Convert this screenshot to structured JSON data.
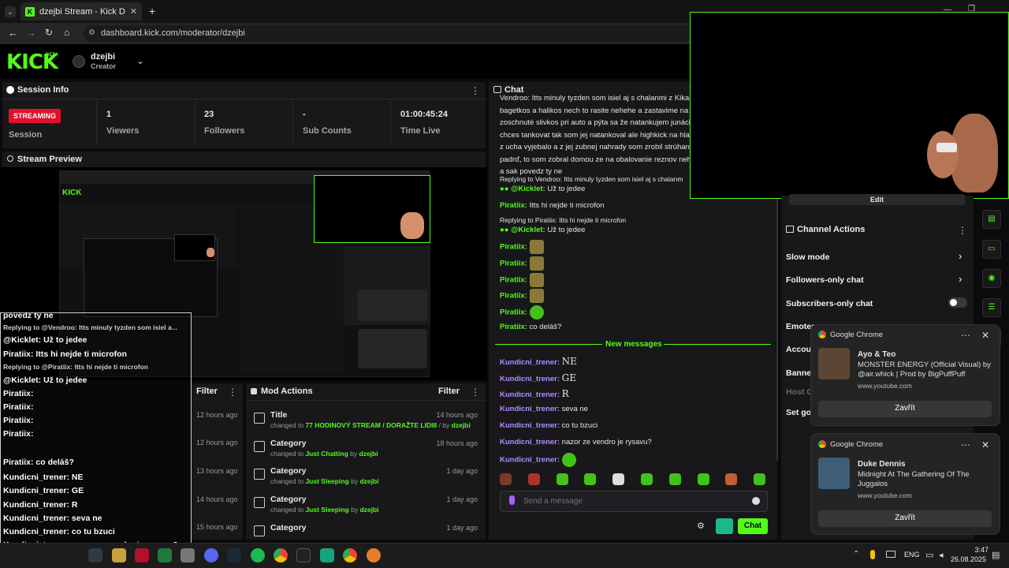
{
  "browser": {
    "tab_title": "dzejbi Stream - Kick Dashboard",
    "url": "dashboard.kick.com/moderator/dzejbi"
  },
  "header": {
    "logo": "KICK",
    "beta": "BETA",
    "username": "dzejbi",
    "role": "Creator"
  },
  "session": {
    "title": "Session Info",
    "status": "STREAMING",
    "session_label": "Session",
    "stats": [
      {
        "value": "1",
        "label": "Viewers"
      },
      {
        "value": "23",
        "label": "Followers"
      },
      {
        "value": "-",
        "label": "Sub Counts"
      },
      {
        "value": "01:00:45:24",
        "label": "Time Live"
      }
    ]
  },
  "preview": {
    "title": "Stream Preview"
  },
  "chat": {
    "title": "Chat",
    "message_lines": [
      "Vendroo: Itts minuly tyzden som isiel aj s chalanmi z Kika na",
      "bagetkos a halikos nech to rasite nehehe a zastavime na",
      "zoschnuté slivkos pri auto a pýta sa že natankujem junáci?",
      "chces tankovat tak som jej natankoval ale highkick na hlavu",
      "z ucha vyjebalo a z jej zubnej nahrady som zrobil strúhanku",
      "padrď, to som zobral domou ze na obalovanie reznov nehehe",
      "a sak povedz ty ne"
    ],
    "reply1": "Replying to Vendroo: Itts minuly tyzden som isiel aj s chalanm",
    "kicklet": "@Kicklet:",
    "kicklet_msg": "Už to jedee",
    "piratiix": "Piratiix:",
    "piratiix_msg1": "Itts hi nejde ti microfon",
    "reply2": "Replying to Piratiix: Itts hi nejde ti microfon",
    "piratiix_last": "co deláš?",
    "new_messages": "New messages",
    "kundicni": "Kundicni_trener:",
    "kundicni_msgs": [
      "NE",
      "GE",
      "R",
      "seva ne",
      "co tu bzuci",
      "nazor ze vendro je rysavu?"
    ],
    "input_placeholder": "Send a message",
    "send": "Chat"
  },
  "mod_actions": {
    "title": "Mod Actions",
    "filter": "Filter",
    "items": [
      {
        "type": "Title",
        "prefix": "changed to",
        "value": "77 HODINOVÝ STREAM / DORAŽTE LIDIII",
        "by": "/ by",
        "user": "dzejbi",
        "time": "14 hours ago"
      },
      {
        "type": "Category",
        "prefix": "changed to",
        "value": "Just Chatting",
        "by": "by",
        "user": "dzejbi",
        "time": "18 hours ago"
      },
      {
        "type": "Category",
        "prefix": "changed to",
        "value": "Just Sleeping",
        "by": "by",
        "user": "dzejbi",
        "time": "1 day ago"
      },
      {
        "type": "Category",
        "prefix": "changed to",
        "value": "Just Sleeping",
        "by": "by",
        "user": "dzejbi",
        "time": "1 day ago"
      },
      {
        "type": "Category",
        "prefix": "",
        "value": "",
        "by": "",
        "user": "",
        "time": "1 day ago"
      }
    ]
  },
  "activity": {
    "filter": "Filter",
    "times": [
      "12 hours ago",
      "12 hours ago",
      "13 hours ago",
      "14 hours ago",
      "15 hours ago"
    ]
  },
  "channel_actions": {
    "title": "Channel Actions",
    "edit": "Edit",
    "items": [
      "Slow mode",
      "Followers-only chat",
      "Subscribers-only chat",
      "Emotes",
      "Accou",
      "Banne",
      "Host C",
      "Set go"
    ]
  },
  "notifications": [
    {
      "app": "Google Chrome",
      "title": "Ayo & Teo",
      "body": "MONSTER ENERGY (Official Visual) by @air.whick | Prod by BigPuffPuff",
      "source": "www.youtube.com",
      "button": "Zavřít"
    },
    {
      "app": "Google Chrome",
      "title": "Duke Dennis",
      "body": "Midnight At The Gathering Of The Juggalos",
      "source": "www.youtube.com",
      "button": "Zavřít"
    }
  ],
  "overlay": {
    "lines": [
      "povedz ty ne",
      "Replying to @Vendroo: Itts minuly tyzden som isiel a...",
      "@Kicklet: Už to jedee",
      "Piratiix: Itts hi nejde ti microfon",
      "Replying to @Piratiix: Itts hi nejde ti microfon",
      "@Kicklet: Už to jedee",
      "Piratiix:",
      "Piratiix:",
      "Piratiix:",
      "Piratiix:",
      "Piratiix: co deláš?",
      "Kundicni_trener: NE",
      "Kundicni_trener: GE",
      "Kundicni_trener: R",
      "Kundicni_trener: seva ne",
      "Kundicni_trener: co tu bzuci",
      "Kundicni_trener: nazor ze vendro je rysavu?",
      "Kundicni_trener:"
    ]
  },
  "taskbar": {
    "lang": "ENG",
    "time": "3:47",
    "date": "26.08.2025"
  }
}
